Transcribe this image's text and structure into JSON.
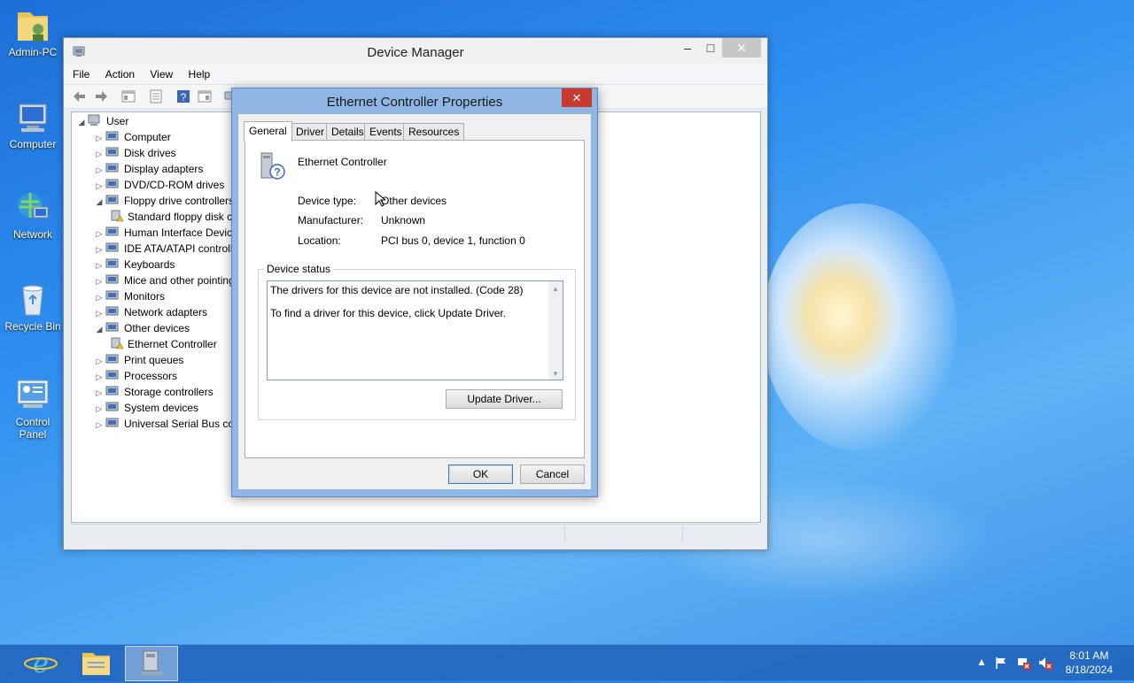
{
  "desktop": {
    "icons": [
      {
        "label": "Admin-PC",
        "icon": "user-folder-icon"
      },
      {
        "label": "Computer",
        "icon": "computer-icon"
      },
      {
        "label": "Network",
        "icon": "network-icon"
      },
      {
        "label": "Recycle Bin",
        "icon": "recycle-bin-icon"
      },
      {
        "label": "Control Panel",
        "icon": "control-panel-icon"
      }
    ]
  },
  "device_manager": {
    "title": "Device Manager",
    "controls": {
      "minimize": "–",
      "maximize": "□",
      "close": "✕"
    },
    "menu": [
      "File",
      "Action",
      "View",
      "Help"
    ],
    "tree": {
      "root": "User",
      "items": [
        {
          "label": "Computer",
          "expanded": false
        },
        {
          "label": "Disk drives",
          "expanded": false
        },
        {
          "label": "Display adapters",
          "expanded": false
        },
        {
          "label": "DVD/CD-ROM drives",
          "expanded": false
        },
        {
          "label": "Floppy drive controllers",
          "expanded": true
        },
        {
          "label": "Standard floppy disk controller",
          "child": true
        },
        {
          "label": "Human Interface Devices",
          "expanded": false
        },
        {
          "label": "IDE ATA/ATAPI controllers",
          "expanded": false
        },
        {
          "label": "Keyboards",
          "expanded": false
        },
        {
          "label": "Mice and other pointing devices",
          "expanded": false
        },
        {
          "label": "Monitors",
          "expanded": false
        },
        {
          "label": "Network adapters",
          "expanded": false
        },
        {
          "label": "Other devices",
          "expanded": true
        },
        {
          "label": "Ethernet Controller",
          "child": true
        },
        {
          "label": "Print queues",
          "expanded": false
        },
        {
          "label": "Processors",
          "expanded": false
        },
        {
          "label": "Storage controllers",
          "expanded": false
        },
        {
          "label": "System devices",
          "expanded": false
        },
        {
          "label": "Universal Serial Bus controllers",
          "expanded": false
        }
      ]
    }
  },
  "dialog": {
    "title": "Ethernet Controller Properties",
    "close": "✕",
    "tabs": [
      "General",
      "Driver",
      "Details",
      "Events",
      "Resources"
    ],
    "active_tab": "General",
    "device_name": "Ethernet Controller",
    "fields": {
      "device_type_label": "Device type:",
      "device_type_value": "Other devices",
      "manufacturer_label": "Manufacturer:",
      "manufacturer_value": "Unknown",
      "location_label": "Location:",
      "location_value": "PCI bus 0, device 1, function 0"
    },
    "status_group_label": "Device status",
    "status_line1": "The drivers for this device are not installed. (Code 28)",
    "status_line2": "To find a driver for this device, click Update Driver.",
    "update_driver_button": "Update Driver...",
    "ok_button": "OK",
    "cancel_button": "Cancel"
  },
  "taskbar": {
    "apps": [
      "internet-explorer-icon",
      "file-explorer-icon",
      "device-manager-icon"
    ],
    "time": "8:01 AM",
    "date": "8/18/2024"
  },
  "colors": {
    "desktop": "#2f8ff0",
    "taskbar": "#2266be",
    "dialog_frame": "#8fb6e4",
    "close_button": "#c93a2e"
  }
}
